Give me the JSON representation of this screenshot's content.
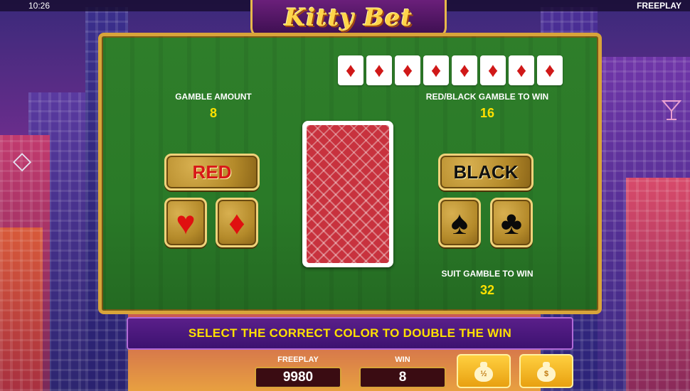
{
  "status_bar": {
    "time": "10:26",
    "mode": "FREEPLAY"
  },
  "logo": {
    "text": "Kitty Bet"
  },
  "history": {
    "cards": [
      "♦",
      "♦",
      "♦",
      "♦",
      "♦",
      "♦",
      "♦",
      "♦"
    ]
  },
  "gamble_amount": {
    "label": "GAMBLE AMOUNT",
    "value": "8"
  },
  "red_black": {
    "label": "RED/BLACK GAMBLE TO WIN",
    "value": "16"
  },
  "suit_gamble": {
    "label": "SUIT GAMBLE TO WIN",
    "value": "32"
  },
  "buttons": {
    "red": "RED",
    "black": "BLACK",
    "hearts": "♥",
    "diamonds": "♦",
    "spades": "♠",
    "clubs": "♣",
    "collect_half": "½",
    "collect_all": "$"
  },
  "message": "SELECT THE CORRECT COLOR TO DOUBLE THE WIN",
  "footer": {
    "freeplay_label": "FREEPLAY",
    "freeplay_value": "9980",
    "win_label": "WIN",
    "win_value": "8"
  },
  "colors": {
    "panel_green": "#2f7e2a",
    "gold": "#d8a43a",
    "message_purple": "#4a1880",
    "accent_yellow": "#ffe000"
  },
  "icons": {
    "diamond_decor": "◇",
    "cocktail_decor": "🍸"
  }
}
